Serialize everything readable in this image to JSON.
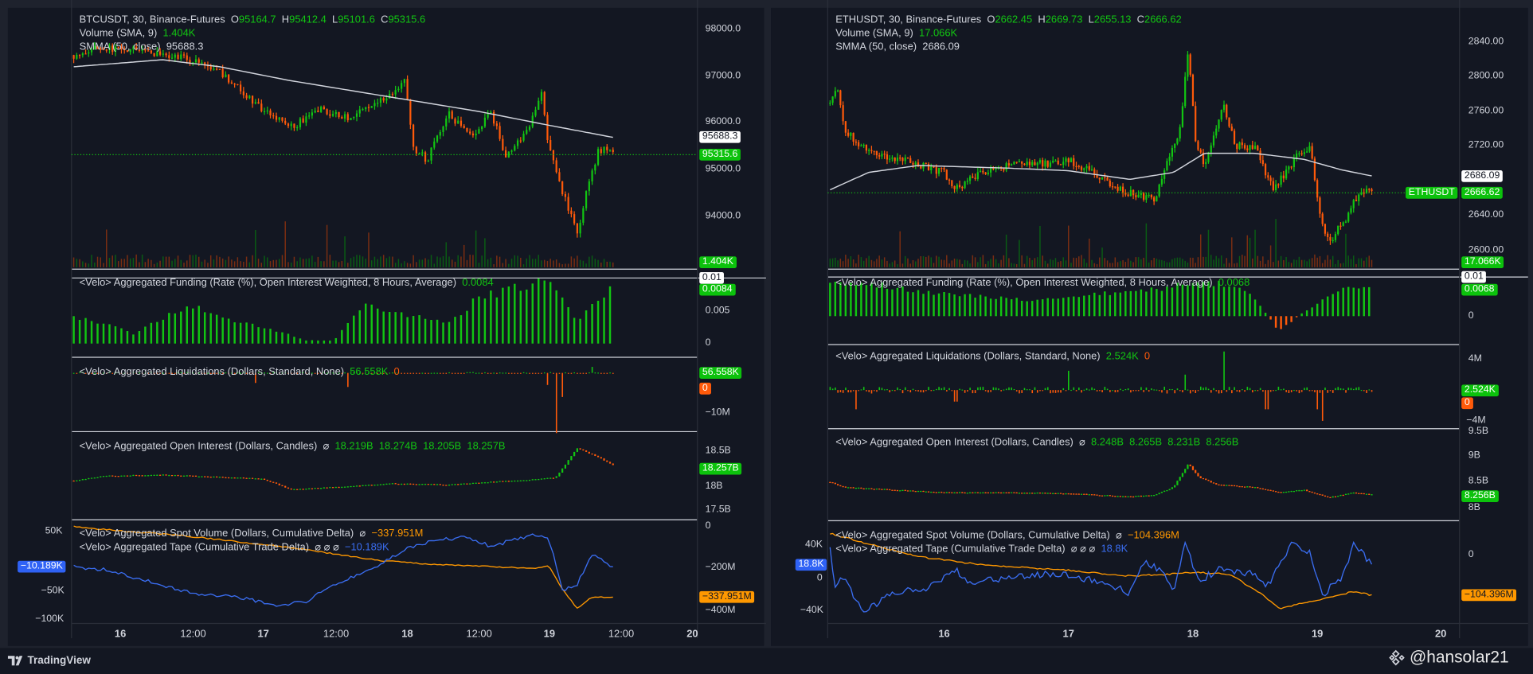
{
  "btc": {
    "header": {
      "symbol": "BTCUSDT, 30, Binance-Futures",
      "o_label": "O",
      "o": "95164.7",
      "h_label": "H",
      "h": "95412.4",
      "l_label": "L",
      "l": "95101.6",
      "c_label": "C",
      "c": "95315.6",
      "volume_label": "Volume (SMA, 9)",
      "volume_value": "1.404K",
      "smma_label": "SMMA (50, close)",
      "smma_value": "95688.3"
    },
    "price_axis": [
      "98000.0",
      "97000.0",
      "96000.0",
      "95000.0",
      "94000.0"
    ],
    "badges": {
      "smma": "95688.3",
      "last": "95315.6",
      "volume": "1.404K",
      "funding_level": "0.01",
      "funding": "0.0084",
      "liq_long": "56.558K",
      "liq_short": "0",
      "oi": "18.257B",
      "spot": "−337.951M",
      "tape": "−10.189K"
    },
    "funding": {
      "title": "<Velo> Aggregated Funding (Rate (%), Open Interest Weighted, 8 Hours, Average)",
      "value": "0.0084",
      "axis": [
        "0.005",
        "0"
      ]
    },
    "liquidations": {
      "title": "<Velo> Aggregated Liquidations (Dollars, Standard, None)",
      "value1": "56.558K",
      "value2": "0",
      "axis": [
        "−10M"
      ]
    },
    "open_interest": {
      "title": "<Velo> Aggregated Open Interest (Dollars, Candles)",
      "icon": "⌀",
      "o": "18.219B",
      "h": "18.274B",
      "l": "18.205B",
      "c": "18.257B",
      "axis": [
        "18.5B",
        "18B",
        "17.5B"
      ]
    },
    "spot": {
      "title": "<Velo> Aggregated Spot Volume (Dollars, Cumulative Delta)",
      "icon": "⌀",
      "value": "−337.951M",
      "axis": [
        "0",
        "−200M",
        "−400M"
      ]
    },
    "tape": {
      "title": "<Velo> Aggregated Tape (Cumulative Trade Delta)",
      "icons": "⌀ ⌀ ⌀",
      "value": "−10.189K",
      "left_axis": [
        "50K",
        "−50K",
        "−100K"
      ]
    },
    "time_axis": [
      "16",
      "12:00",
      "17",
      "12:00",
      "18",
      "12:00",
      "19",
      "12:00",
      "20"
    ]
  },
  "eth": {
    "header": {
      "symbol": "ETHUSDT, 30, Binance-Futures",
      "o_label": "O",
      "o": "2662.45",
      "h_label": "H",
      "h": "2669.73",
      "l_label": "L",
      "l": "2655.13",
      "c_label": "C",
      "c": "2666.62",
      "volume_label": "Volume (SMA, 9)",
      "volume_value": "17.066K",
      "smma_label": "SMMA (50, close)",
      "smma_value": "2686.09"
    },
    "price_axis": [
      "2840.00",
      "2800.00",
      "2760.00",
      "2720.00",
      "2640.00",
      "2600.00"
    ],
    "badges": {
      "smma": "2686.09",
      "symbol": "ETHUSDT",
      "last": "2666.62",
      "volume": "17.066K",
      "funding_level": "0.01",
      "funding": "0.0068",
      "liq_long": "2.524K",
      "liq_short": "0",
      "oi": "8.256B",
      "spot": "−104.396M",
      "tape": "18.8K"
    },
    "funding": {
      "title": "<Velo> Aggregated Funding (Rate (%), Open Interest Weighted, 8 Hours, Average)",
      "value": "0.0068",
      "axis": [
        "0"
      ]
    },
    "liquidations": {
      "title": "<Velo> Aggregated Liquidations (Dollars, Standard, None)",
      "value1": "2.524K",
      "value2": "0",
      "axis": [
        "4M",
        "−4M"
      ]
    },
    "open_interest": {
      "title": "<Velo> Aggregated Open Interest (Dollars, Candles)",
      "icon": "⌀",
      "o": "8.248B",
      "h": "8.265B",
      "l": "8.231B",
      "c": "8.256B",
      "axis": [
        "9.5B",
        "9B",
        "8.5B",
        "8B"
      ]
    },
    "spot": {
      "title": "<Velo> Aggregated Spot Volume (Dollars, Cumulative Delta)",
      "icon": "⌀",
      "value": "−104.396M",
      "axis": [
        "0"
      ]
    },
    "tape": {
      "title": "<Velo> Aggregated Tape (Cumulative Trade Delta)",
      "icons": "⌀ ⌀ ⌀",
      "value": "18.8K",
      "left_axis": [
        "40K",
        "0",
        "−40K"
      ]
    },
    "time_axis": [
      "16",
      "17",
      "18",
      "19",
      "20"
    ]
  },
  "footer": {
    "brand": "TradingView",
    "watermark": "@hansolar21"
  },
  "colors": {
    "up": "#12c512",
    "down": "#ff5a0a",
    "spot": "#ff9800",
    "tape": "#3a6df0",
    "smma": "#d1d4dc"
  },
  "chart_data": [
    {
      "type": "candlestick",
      "name": "BTCUSDT",
      "time_unit": "day-of-month",
      "ylim": [
        93500,
        98200
      ],
      "close_path": [
        [
          15.68,
          97450
        ],
        [
          15.85,
          97600
        ],
        [
          16.1,
          97550
        ],
        [
          16.5,
          97350
        ],
        [
          16.7,
          97100
        ],
        [
          16.85,
          96700
        ],
        [
          17.0,
          96300
        ],
        [
          17.2,
          95900
        ],
        [
          17.4,
          96300
        ],
        [
          17.6,
          96100
        ],
        [
          17.85,
          96500
        ],
        [
          18.0,
          96900
        ],
        [
          18.05,
          95500
        ],
        [
          18.15,
          95200
        ],
        [
          18.3,
          96200
        ],
        [
          18.45,
          95700
        ],
        [
          18.6,
          96200
        ],
        [
          18.7,
          95300
        ],
        [
          18.85,
          95800
        ],
        [
          18.95,
          96700
        ],
        [
          19.0,
          95500
        ],
        [
          19.1,
          94500
        ],
        [
          19.2,
          93600
        ],
        [
          19.28,
          94700
        ],
        [
          19.35,
          95400
        ],
        [
          19.4,
          95500
        ],
        [
          19.45,
          95315
        ]
      ],
      "smma": [
        [
          15.68,
          97200
        ],
        [
          16.3,
          97350
        ],
        [
          16.7,
          97200
        ],
        [
          17.2,
          96900
        ],
        [
          17.6,
          96700
        ],
        [
          18.0,
          96500
        ],
        [
          18.5,
          96250
        ],
        [
          19.0,
          95950
        ],
        [
          19.45,
          95690
        ]
      ],
      "funding": [
        [
          15.68,
          0.004
        ],
        [
          15.9,
          0.003
        ],
        [
          16.1,
          0.0015
        ],
        [
          16.3,
          0.004
        ],
        [
          16.5,
          0.006
        ],
        [
          16.7,
          0.004
        ],
        [
          16.9,
          0.003
        ],
        [
          17.1,
          0.002
        ],
        [
          17.3,
          0.0005
        ],
        [
          17.5,
          0.0005
        ],
        [
          17.7,
          0.006
        ],
        [
          17.9,
          0.005
        ],
        [
          18.1,
          0.004
        ],
        [
          18.3,
          0.003
        ],
        [
          18.5,
          0.007
        ],
        [
          18.7,
          0.008
        ],
        [
          18.9,
          0.0095
        ],
        [
          19.0,
          0.0098
        ],
        [
          19.1,
          0.007
        ],
        [
          19.2,
          0.003
        ],
        [
          19.3,
          0.006
        ],
        [
          19.45,
          0.0084
        ]
      ],
      "liq_spikes": [
        [
          16.95,
          -2500000
        ],
        [
          17.6,
          -3500000
        ],
        [
          19.05,
          -15000000
        ],
        [
          19.1,
          -6000000
        ],
        [
          19.0,
          -3000000
        ],
        [
          19.3,
          1500000
        ]
      ],
      "open_interest": [
        [
          15.68,
          18000000000.0
        ],
        [
          15.9,
          18080000000.0
        ],
        [
          16.3,
          18100000000.0
        ],
        [
          16.8,
          18050000000.0
        ],
        [
          17.0,
          18030000000.0
        ],
        [
          17.2,
          17850000000.0
        ],
        [
          17.6,
          17900000000.0
        ],
        [
          17.9,
          17950000000.0
        ],
        [
          18.3,
          17930000000.0
        ],
        [
          18.6,
          17980000000.0
        ],
        [
          18.9,
          18020000000.0
        ],
        [
          19.05,
          18050000000.0
        ],
        [
          19.2,
          18550000000.0
        ],
        [
          19.35,
          18400000000.0
        ],
        [
          19.45,
          18260000000.0
        ]
      ],
      "spot_cvd": [
        [
          15.68,
          0
        ],
        [
          16.0,
          -20000000.0
        ],
        [
          16.4,
          -40000000.0
        ],
        [
          16.8,
          -70000000.0
        ],
        [
          17.2,
          -100000000.0
        ],
        [
          17.5,
          -130000000.0
        ],
        [
          17.8,
          -160000000.0
        ],
        [
          18.2,
          -180000000.0
        ],
        [
          18.6,
          -190000000.0
        ],
        [
          18.9,
          -200000000.0
        ],
        [
          19.0,
          -185000000.0
        ],
        [
          19.1,
          -300000000.0
        ],
        [
          19.2,
          -390000000.0
        ],
        [
          19.3,
          -335000000.0
        ],
        [
          19.45,
          -338000000.0
        ]
      ],
      "tape_cvd": [
        [
          15.68,
          -10000.0
        ],
        [
          15.9,
          -15000.0
        ],
        [
          16.2,
          -35000.0
        ],
        [
          16.5,
          -55000.0
        ],
        [
          16.8,
          -60000.0
        ],
        [
          17.1,
          -75000.0
        ],
        [
          17.3,
          -70000.0
        ],
        [
          17.5,
          -40000.0
        ],
        [
          17.8,
          -10000.0
        ],
        [
          18.0,
          20000.0
        ],
        [
          18.2,
          35000.0
        ],
        [
          18.4,
          40000.0
        ],
        [
          18.6,
          25000.0
        ],
        [
          18.9,
          45000.0
        ],
        [
          19.0,
          40000.0
        ],
        [
          19.1,
          -50000.0
        ],
        [
          19.2,
          -40000.0
        ],
        [
          19.3,
          10000.0
        ],
        [
          19.38,
          0
        ],
        [
          19.45,
          -10000.0
        ]
      ]
    },
    {
      "type": "candlestick",
      "name": "ETHUSDT",
      "time_unit": "day-of-month",
      "ylim": [
        2590,
        2850
      ],
      "close_path": [
        [
          15.09,
          2770
        ],
        [
          15.15,
          2790
        ],
        [
          15.2,
          2740
        ],
        [
          15.35,
          2720
        ],
        [
          15.6,
          2705
        ],
        [
          15.8,
          2700
        ],
        [
          16.0,
          2690
        ],
        [
          16.1,
          2670
        ],
        [
          16.3,
          2690
        ],
        [
          16.6,
          2700
        ],
        [
          16.85,
          2700
        ],
        [
          17.0,
          2705
        ],
        [
          17.2,
          2690
        ],
        [
          17.4,
          2670
        ],
        [
          17.55,
          2665
        ],
        [
          17.7,
          2660
        ],
        [
          17.8,
          2700
        ],
        [
          17.9,
          2740
        ],
        [
          17.97,
          2830
        ],
        [
          18.03,
          2720
        ],
        [
          18.1,
          2700
        ],
        [
          18.25,
          2770
        ],
        [
          18.35,
          2720
        ],
        [
          18.5,
          2720
        ],
        [
          18.65,
          2670
        ],
        [
          18.75,
          2690
        ],
        [
          18.85,
          2710
        ],
        [
          18.95,
          2720
        ],
        [
          19.03,
          2640
        ],
        [
          19.1,
          2610
        ],
        [
          19.25,
          2640
        ],
        [
          19.35,
          2670
        ],
        [
          19.44,
          2667
        ]
      ],
      "smma": [
        [
          15.09,
          2670
        ],
        [
          15.4,
          2690
        ],
        [
          15.8,
          2698
        ],
        [
          16.5,
          2695
        ],
        [
          17.0,
          2692
        ],
        [
          17.5,
          2682
        ],
        [
          17.85,
          2690
        ],
        [
          18.1,
          2712
        ],
        [
          18.5,
          2712
        ],
        [
          18.9,
          2705
        ],
        [
          19.2,
          2693
        ],
        [
          19.44,
          2686
        ]
      ],
      "funding": [
        [
          15.09,
          0.009
        ],
        [
          15.5,
          0.008
        ],
        [
          15.9,
          0.006
        ],
        [
          16.3,
          0.005
        ],
        [
          16.7,
          0.004
        ],
        [
          17.0,
          0.005
        ],
        [
          17.4,
          0.006
        ],
        [
          17.8,
          0.007
        ],
        [
          18.0,
          0.009
        ],
        [
          18.3,
          0.008
        ],
        [
          18.5,
          0.005
        ],
        [
          18.7,
          -0.004
        ],
        [
          18.85,
          0.0
        ],
        [
          19.05,
          0.004
        ],
        [
          19.2,
          0.007
        ],
        [
          19.44,
          0.0068
        ]
      ],
      "liq_spikes": [
        [
          17.0,
          2500000
        ],
        [
          17.95,
          2000000
        ],
        [
          18.25,
          5000000
        ],
        [
          15.3,
          -2500000
        ],
        [
          18.6,
          -2500000
        ],
        [
          19.05,
          -4000000
        ],
        [
          19.0,
          -2500000
        ],
        [
          16.1,
          -1500000
        ]
      ],
      "open_interest": [
        [
          15.09,
          8500000000.0
        ],
        [
          15.2,
          8400000000.0
        ],
        [
          15.6,
          8350000000.0
        ],
        [
          16.0,
          8300000000.0
        ],
        [
          16.5,
          8300000000.0
        ],
        [
          17.0,
          8280000000.0
        ],
        [
          17.5,
          8220000000.0
        ],
        [
          17.7,
          8250000000.0
        ],
        [
          17.85,
          8400000000.0
        ],
        [
          17.97,
          8850000000.0
        ],
        [
          18.05,
          8600000000.0
        ],
        [
          18.2,
          8450000000.0
        ],
        [
          18.5,
          8400000000.0
        ],
        [
          18.7,
          8300000000.0
        ],
        [
          18.9,
          8350000000.0
        ],
        [
          19.1,
          8200000000.0
        ],
        [
          19.3,
          8300000000.0
        ],
        [
          19.44,
          8256000000.0
        ]
      ],
      "spot_cvd": [
        [
          15.09,
          56000000.0
        ],
        [
          15.5,
          20000000.0
        ],
        [
          15.8,
          -5000000.0
        ],
        [
          16.3,
          -25000000.0
        ],
        [
          17.0,
          -40000000.0
        ],
        [
          17.5,
          -55000000.0
        ],
        [
          17.8,
          -50000000.0
        ],
        [
          18.0,
          -45000000.0
        ],
        [
          18.3,
          -50000000.0
        ],
        [
          18.55,
          -100000000.0
        ],
        [
          18.7,
          -140000000.0
        ],
        [
          18.9,
          -125000000.0
        ],
        [
          19.1,
          -110000000.0
        ],
        [
          19.3,
          -95000000.0
        ],
        [
          19.44,
          -104400000.0
        ]
      ],
      "tape_cvd": [
        [
          15.09,
          40000.0
        ],
        [
          15.12,
          -10000.0
        ],
        [
          15.2,
          0
        ],
        [
          15.35,
          -40000.0
        ],
        [
          15.6,
          -20000.0
        ],
        [
          15.9,
          -10000.0
        ],
        [
          16.1,
          10000.0
        ],
        [
          16.2,
          -5000.0
        ],
        [
          16.5,
          0
        ],
        [
          16.9,
          5000.0
        ],
        [
          17.3,
          -5000.0
        ],
        [
          17.5,
          -20000.0
        ],
        [
          17.6,
          20000.0
        ],
        [
          17.75,
          10000.0
        ],
        [
          17.85,
          -15000.0
        ],
        [
          17.95,
          45000.0
        ],
        [
          18.05,
          -5000.0
        ],
        [
          18.2,
          10000.0
        ],
        [
          18.5,
          5000.0
        ],
        [
          18.6,
          -10000.0
        ],
        [
          18.8,
          40000.0
        ],
        [
          18.95,
          30000.0
        ],
        [
          19.05,
          -20000.0
        ],
        [
          19.2,
          0
        ],
        [
          19.3,
          40000.0
        ],
        [
          19.44,
          18800.0
        ]
      ]
    }
  ]
}
